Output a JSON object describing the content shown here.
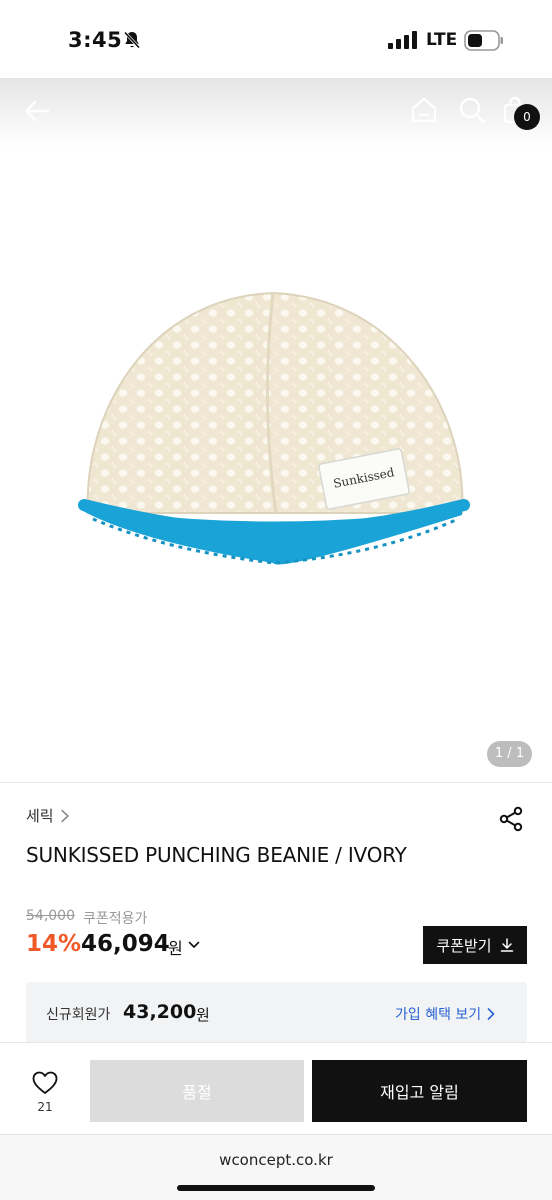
{
  "status_bar": {
    "time": "3:45",
    "network": "LTE"
  },
  "header": {
    "cart_count": "0"
  },
  "gallery": {
    "pager": "1 / 1",
    "image_label": "Sunkissed"
  },
  "product": {
    "brand": "세릭",
    "title": "SUNKISSED PUNCHING BEANIE / IVORY",
    "original_price": "54,000",
    "coupon_note": "쿠폰적용가",
    "discount": "14%",
    "sale_price": "46,094",
    "currency_unit": "원",
    "coupon_button": "쿠폰받기"
  },
  "member": {
    "label": "신규회원가",
    "price": "43,200",
    "unit": "원",
    "link": "가입 혜택 보기"
  },
  "bottom_bar": {
    "wish_count": "21",
    "soldout_label": "품절",
    "restock_label": "재입고 알림"
  },
  "browser": {
    "url": "wconcept.co.kr"
  },
  "colors": {
    "accent_discount": "#f05a28",
    "link_blue": "#2a63d4",
    "primary_black": "#111111",
    "beanie_ivory": "#efe7d2",
    "beanie_trim": "#1aa3d6"
  }
}
